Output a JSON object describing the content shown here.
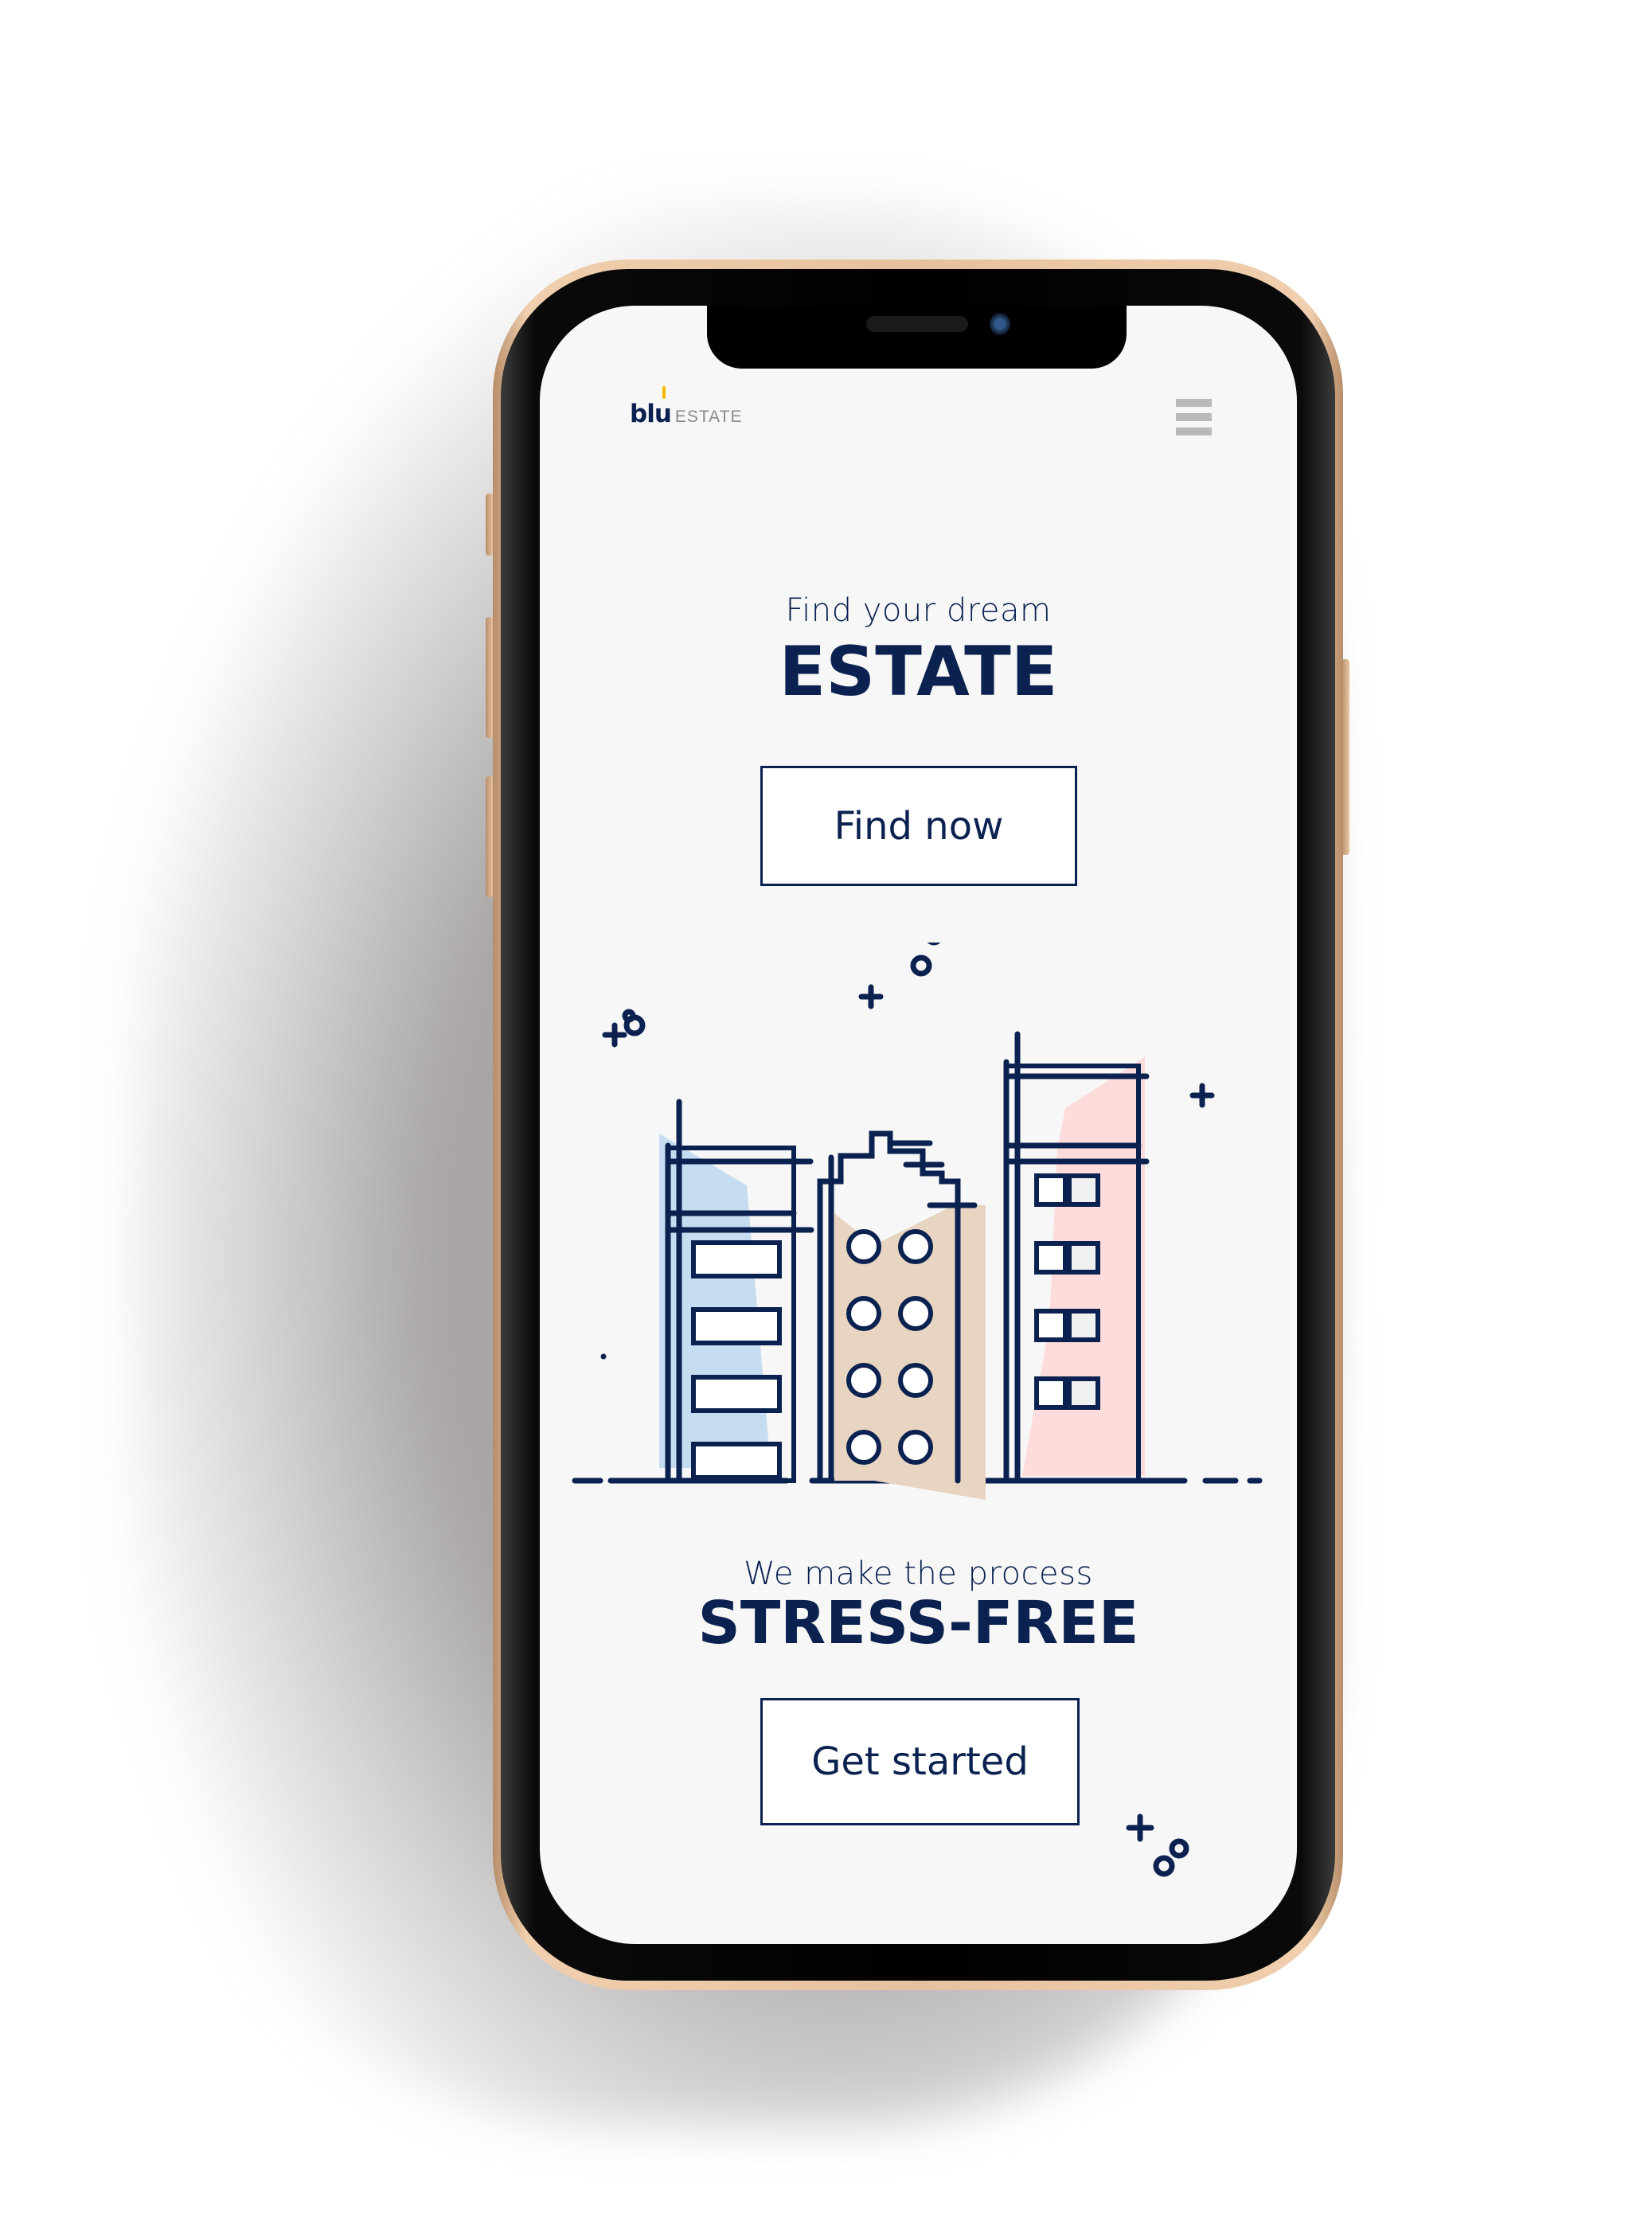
{
  "app": {
    "brand": {
      "name_part1": "blu",
      "name_part2": "ESTATE",
      "accent_color": "#f5b800",
      "primary_color": "#0b2250"
    },
    "header": {
      "menu_icon": "hamburger-menu-icon"
    },
    "hero": {
      "subtitle": "Find your dream",
      "title": "ESTATE",
      "cta_label": "Find now"
    },
    "illustration": {
      "description": "city-buildings-illustration",
      "building_colors": {
        "blue": "#c6dcf0",
        "tan": "#e8d5c1",
        "pink": "#ffdcdc"
      }
    },
    "section2": {
      "subtitle": "We make the process",
      "title": "STRESS-FREE",
      "cta_label": "Get started"
    }
  }
}
